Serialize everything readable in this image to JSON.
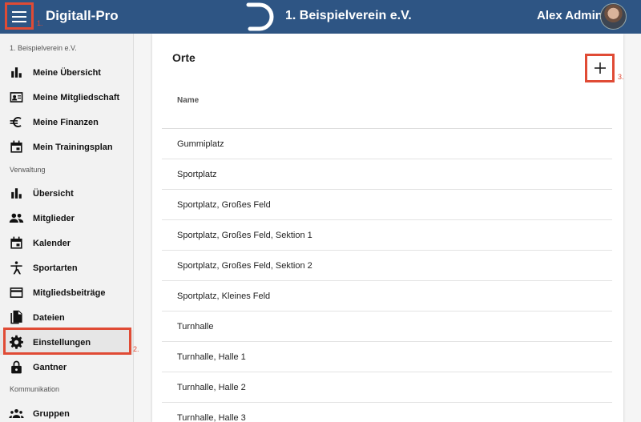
{
  "header": {
    "app_name": "Digitall-Pro",
    "club_name": "1. Beispielverein e.V.",
    "user_name": "Alex Admin",
    "brand_color": "#2e5584"
  },
  "sidebar": {
    "club_label": "1. Beispielverein e.V.",
    "admin_label": "Verwaltung",
    "comm_label": "Kommunikation",
    "personal_items": [
      {
        "label": "Meine Übersicht",
        "icon": "bar-chart-icon"
      },
      {
        "label": "Meine Mitgliedschaft",
        "icon": "id-card-icon"
      },
      {
        "label": "Meine Finanzen",
        "icon": "euro-icon"
      },
      {
        "label": "Mein Trainingsplan",
        "icon": "calendar-icon"
      }
    ],
    "admin_items": [
      {
        "label": "Übersicht",
        "icon": "bar-chart-icon"
      },
      {
        "label": "Mitglieder",
        "icon": "people-icon"
      },
      {
        "label": "Kalender",
        "icon": "calendar-icon"
      },
      {
        "label": "Sportarten",
        "icon": "person-exercise-icon"
      },
      {
        "label": "Mitgliedsbeiträge",
        "icon": "credit-card-icon"
      },
      {
        "label": "Dateien",
        "icon": "files-icon"
      },
      {
        "label": "Einstellungen",
        "icon": "gear-icon",
        "active": true
      },
      {
        "label": "Gantner",
        "icon": "lock-icon"
      }
    ],
    "comm_items": [
      {
        "label": "Gruppen",
        "icon": "groups-icon"
      }
    ]
  },
  "main": {
    "title": "Orte",
    "column_header": "Name",
    "rows": [
      "Gummiplatz",
      "Sportplatz",
      "Sportplatz, Großes Feld",
      "Sportplatz, Großes Feld, Sektion 1",
      "Sportplatz, Großes Feld, Sektion 2",
      "Sportplatz, Kleines Feld",
      "Turnhalle",
      "Turnhalle, Halle 1",
      "Turnhalle, Halle 2",
      "Turnhalle, Halle 3"
    ]
  },
  "annotations": {
    "one": "1.",
    "two": "2.",
    "three": "3.",
    "color": "#e04b35"
  }
}
